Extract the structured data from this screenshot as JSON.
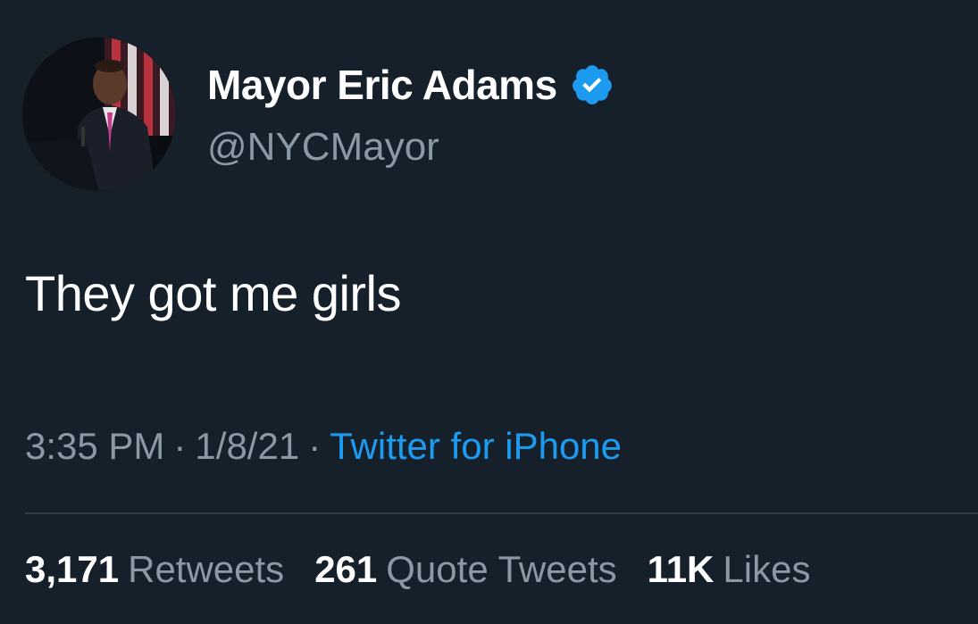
{
  "author": {
    "display_name": "Mayor Eric Adams",
    "handle": "@NYCMayor",
    "verified": true,
    "avatar": "avatar-photo"
  },
  "tweet": {
    "text": "They got me girls"
  },
  "meta": {
    "time": "3:35 PM",
    "separator": "·",
    "date": "1/8/21",
    "source": "Twitter for iPhone"
  },
  "stats": {
    "retweets_count": "3,171",
    "retweets_label": "Retweets",
    "quote_count": "261",
    "quote_label": "Quote Tweets",
    "likes_count": "11K",
    "likes_label": "Likes"
  },
  "colors": {
    "background": "#15202b",
    "verified_blue": "#1d9bf0",
    "secondary_text": "#8b98a5",
    "link": "#1d9bf0"
  }
}
